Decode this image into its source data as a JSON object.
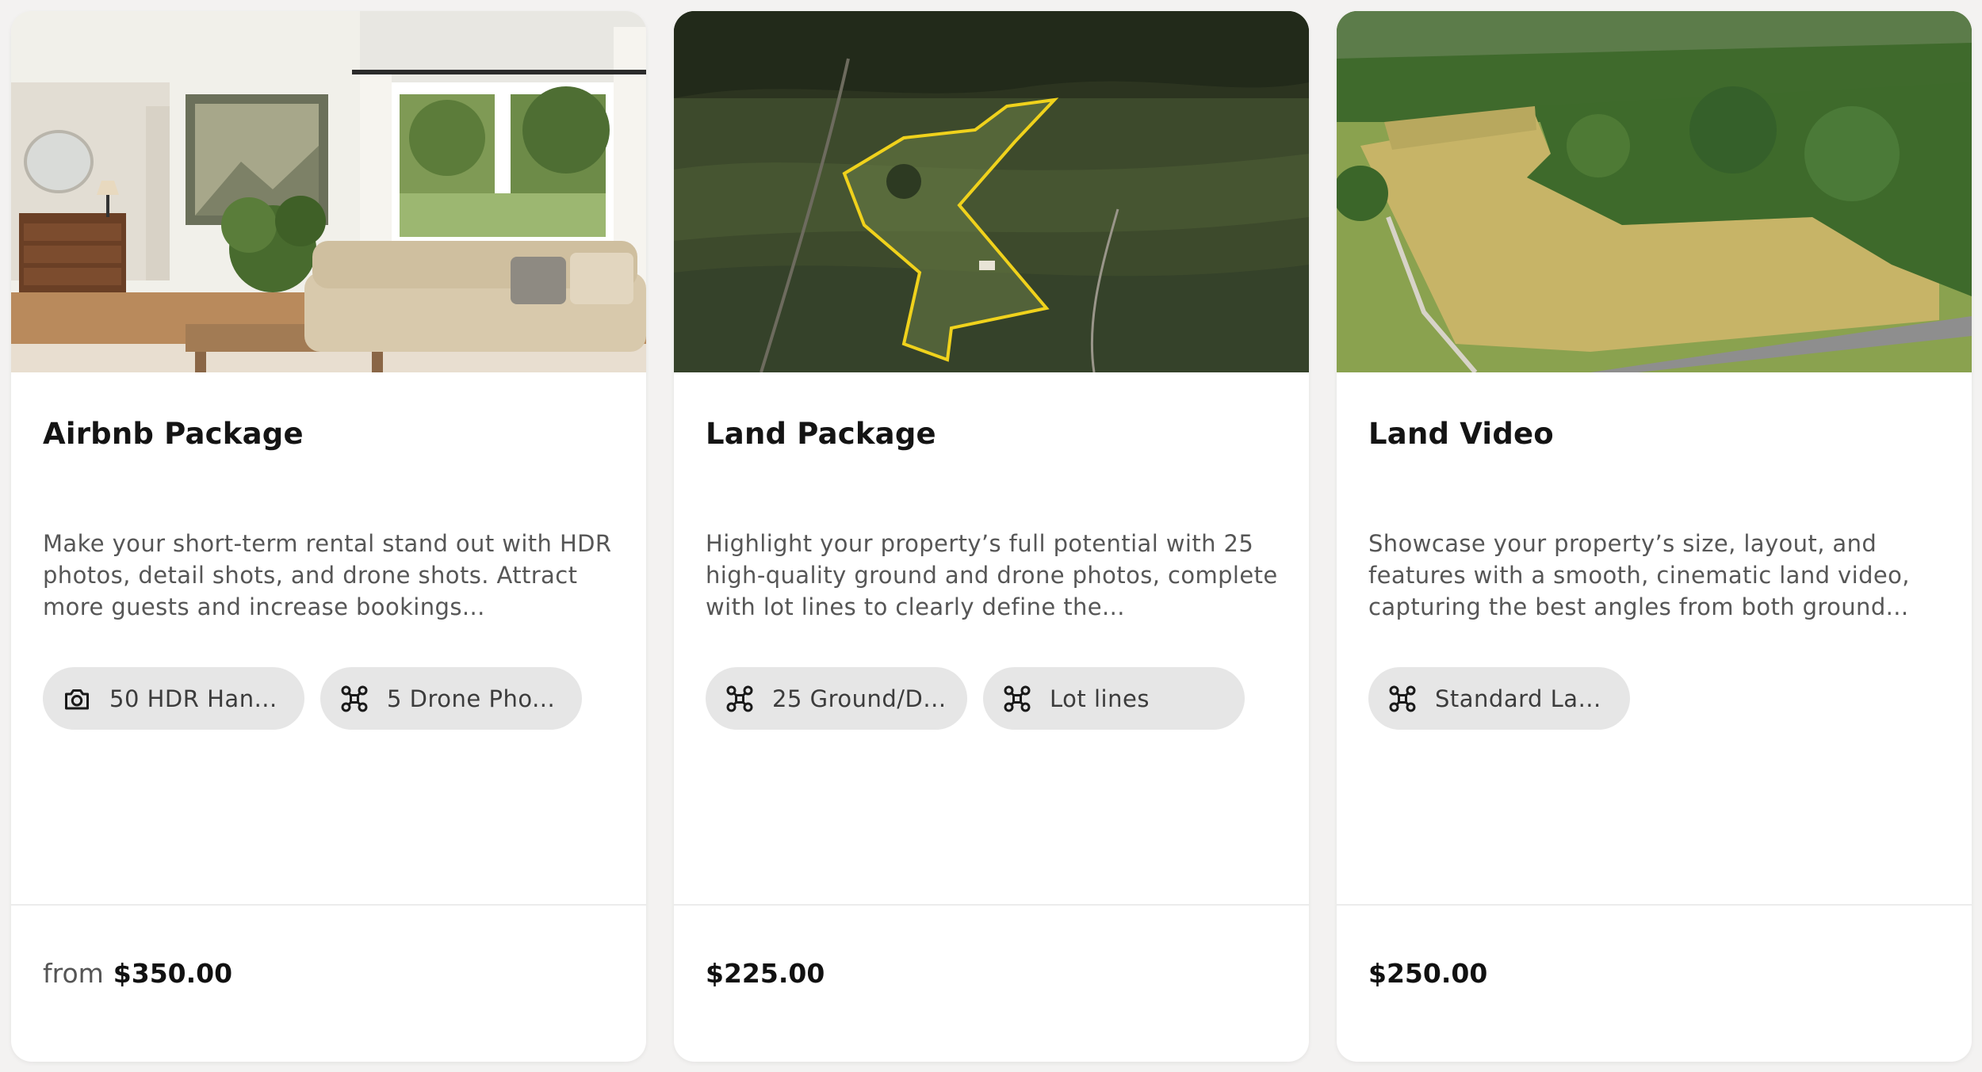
{
  "cards": [
    {
      "title": "Airbnb Package",
      "description": "Make your short-term rental stand out with HDR photos, detail shots, and drone shots. Attract more guests and increase bookings...",
      "chips": [
        {
          "icon": "camera-icon",
          "label": "50 HDR Han..."
        },
        {
          "icon": "drone-icon",
          "label": "5 Drone Pho..."
        }
      ],
      "price_prefix": "from",
      "price": "$350.00"
    },
    {
      "title": "Land Package",
      "description": "Highlight your property’s full potential with 25 high-quality ground and drone photos, complete with lot lines to clearly define the...",
      "chips": [
        {
          "icon": "drone-icon",
          "label": "25 Ground/D..."
        },
        {
          "icon": "drone-icon",
          "label": "Lot lines"
        }
      ],
      "price": "$225.00"
    },
    {
      "title": "Land Video",
      "description": "Showcase your property’s size, layout, and features with a smooth, cinematic land video, capturing the best angles from both ground...",
      "chips": [
        {
          "icon": "drone-icon",
          "label": "Standard La..."
        }
      ],
      "price": "$250.00"
    }
  ],
  "colors": {
    "chip_background": "#e6e6e6",
    "lot_line": "#f0d21c"
  }
}
